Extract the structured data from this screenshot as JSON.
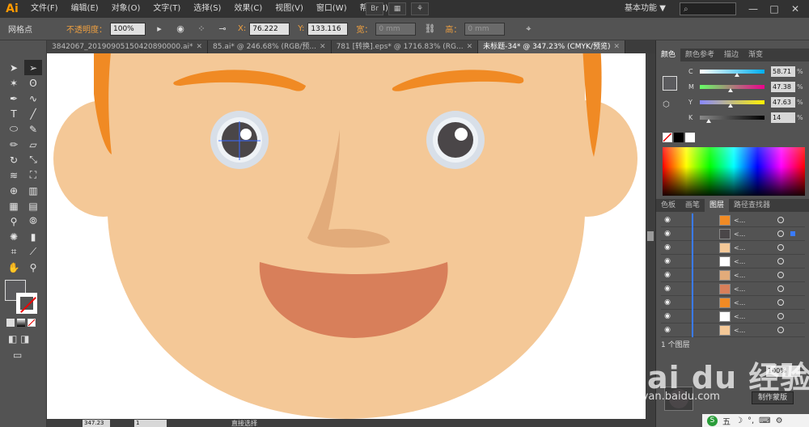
{
  "app": {
    "logo": "Ai",
    "menu": [
      "文件(F)",
      "编辑(E)",
      "对象(O)",
      "文字(T)",
      "选择(S)",
      "效果(C)",
      "视图(V)",
      "窗口(W)",
      "帮助(H)"
    ],
    "menu_btn_br": "Br",
    "workspace": "基本功能",
    "workspace_arrow": "▼",
    "window_buttons": [
      "—",
      "□",
      "✕"
    ]
  },
  "control_bar": {
    "mode_label": "网格点",
    "opacity_label": "不透明度：",
    "opacity_value": "100%",
    "x_label": "X:",
    "x_value": "76.222",
    "y_label": "Y:",
    "y_value": "133.116",
    "w_label": "宽：",
    "w_value": "0 mm",
    "h_label": "高：",
    "h_value": "0 mm"
  },
  "tabs": [
    {
      "label": "3842067_20190905150420890000.ai*",
      "close": "✕",
      "active": false
    },
    {
      "label": "85.ai* @ 246.68% (RGB/预...",
      "close": "✕",
      "active": false
    },
    {
      "label": "781 [转换].eps* @ 1716.83% (RG...",
      "close": "✕",
      "active": false
    },
    {
      "label": "未标题-34* @ 347.23% (CMYK/预览)",
      "close": "✕",
      "active": true
    }
  ],
  "color_panel": {
    "tabs": [
      "颜色",
      "颜色参考",
      "描边",
      "渐变"
    ],
    "channels": [
      {
        "label": "C",
        "value": "58.71",
        "unit": "%",
        "knob": 0.58
      },
      {
        "label": "M",
        "value": "47.38",
        "unit": "%",
        "knob": 0.47
      },
      {
        "label": "Y",
        "value": "47.63",
        "unit": "%",
        "knob": 0.47
      },
      {
        "label": "K",
        "value": "14",
        "unit": "%",
        "knob": 0.14
      }
    ]
  },
  "layers_panel": {
    "tabs": [
      "色板",
      "画笔",
      "图层",
      "路径查找器"
    ],
    "row_names": [
      "<...",
      "<...",
      "<...",
      "<...",
      "<...",
      "<...",
      "<...",
      "<...",
      "<..."
    ],
    "count_label": "1 个图层"
  },
  "transparency_panel": {
    "opacity_value": "100%",
    "make_mask_label": "制作蒙版"
  },
  "status_bar": {
    "zoom": "347.23",
    "page": "1",
    "tool": "直接选择"
  },
  "watermark": {
    "brand": "Bai du 经验",
    "url": "jingyan.baidu.com"
  },
  "ime": {
    "items": [
      "S",
      "五",
      "☽",
      "°,",
      "⌨",
      "⚙"
    ]
  },
  "colors": {
    "skin": "#f4c897",
    "hair": "#f08a24",
    "mouth": "#d87f5a",
    "nose": "#e2ab7a",
    "eye_ring": "#d8dfe8",
    "pupil": "#4a4648",
    "accent_orange": "#f0a040"
  }
}
